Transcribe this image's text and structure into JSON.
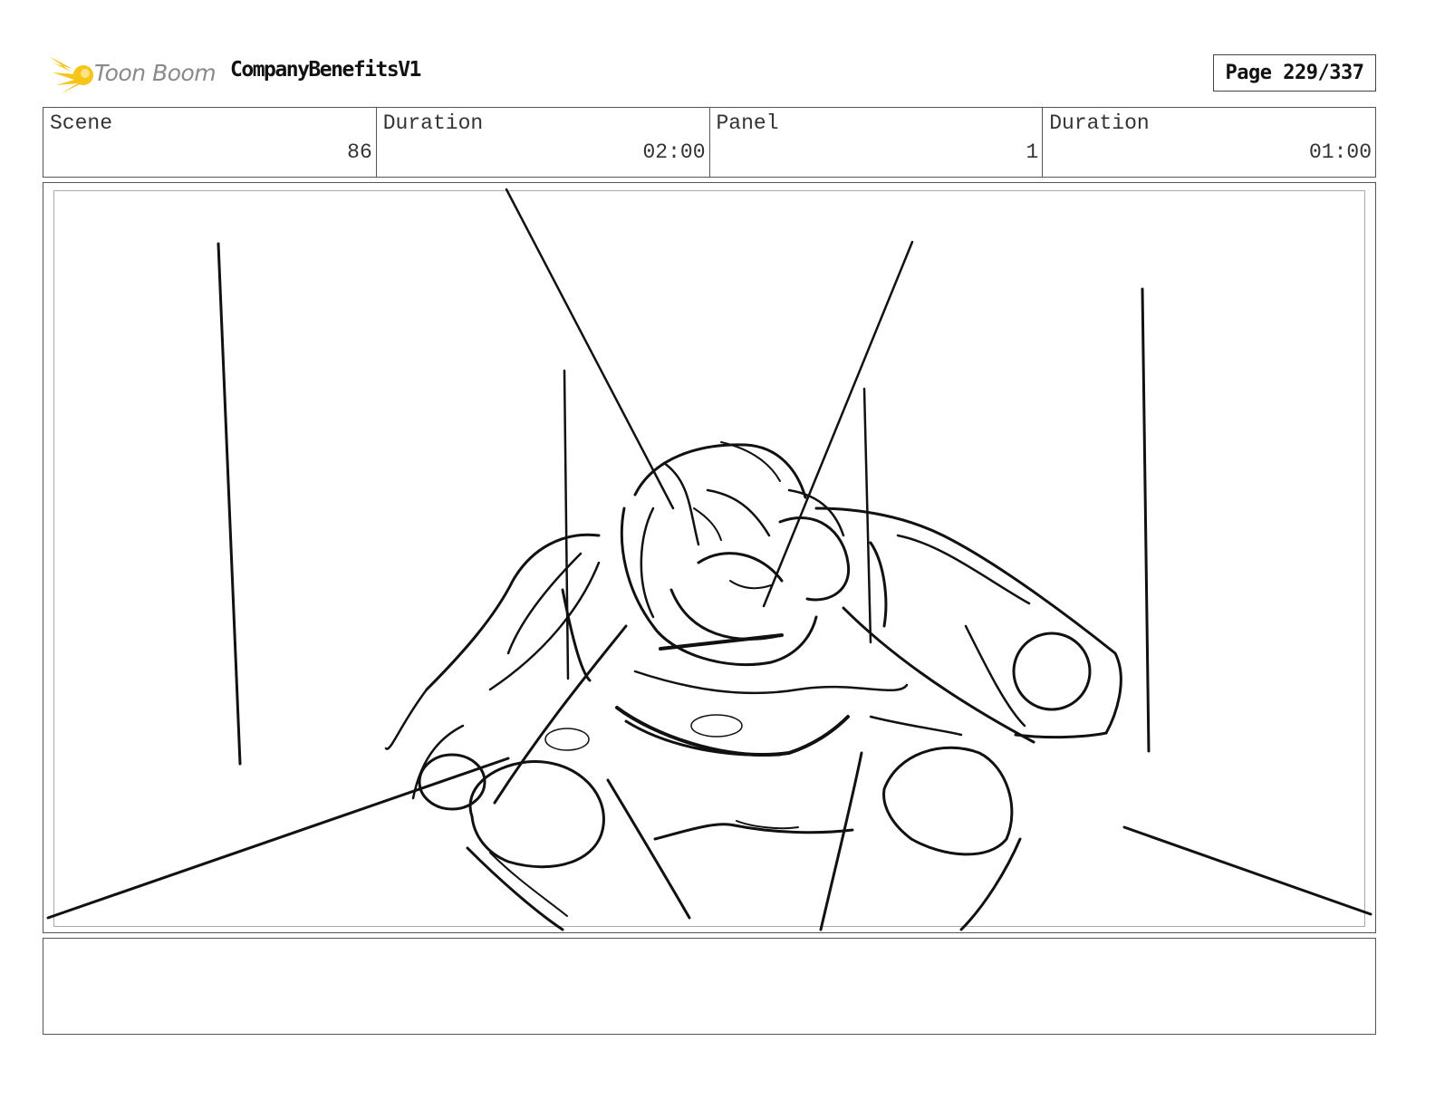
{
  "header": {
    "logo_text": "Toon Boom",
    "project_title": "CompanyBenefitsV1",
    "page_label": "Page 229/337"
  },
  "info": {
    "scene_label": "Scene",
    "scene_value": "86",
    "scene_duration_label": "Duration",
    "scene_duration_value": "02:00",
    "panel_label": "Panel",
    "panel_value": "1",
    "panel_duration_label": "Duration",
    "panel_duration_value": "01:00"
  },
  "notes": {
    "text": ""
  },
  "colors": {
    "logo_accent": "#f5c518",
    "logo_text": "#8a8a8a",
    "border": "#555555",
    "sketch_ink": "#111111"
  }
}
